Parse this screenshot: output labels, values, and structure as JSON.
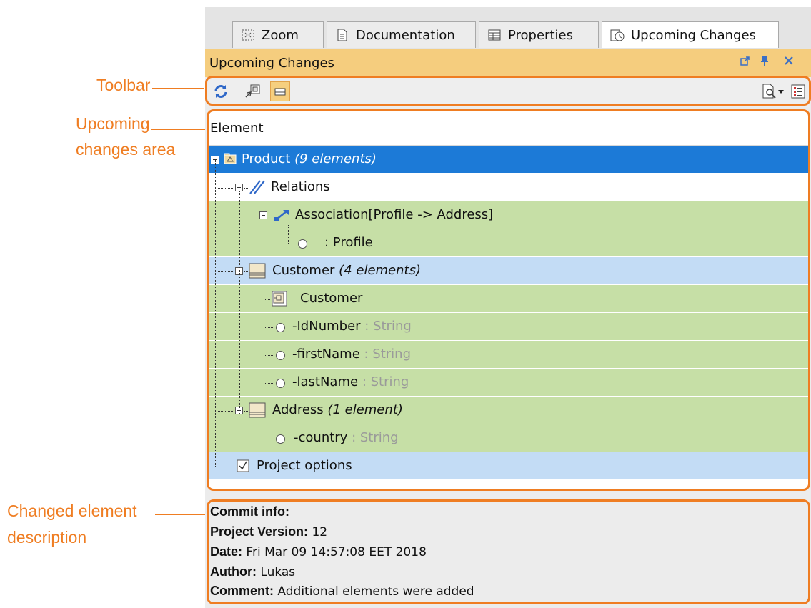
{
  "annotations": {
    "toolbar": "Toolbar",
    "upcoming_area_line1": "Upcoming",
    "upcoming_area_line2": "changes area",
    "description_line1": "Changed element",
    "description_line2": "description"
  },
  "tabs": [
    {
      "label": "Zoom",
      "icon": "zoom-icon"
    },
    {
      "label": "Documentation",
      "icon": "documentation-icon"
    },
    {
      "label": "Properties",
      "icon": "properties-icon"
    },
    {
      "label": "Upcoming Changes",
      "icon": "upcoming-changes-icon",
      "active": true
    }
  ],
  "panel": {
    "title": "Upcoming Changes",
    "controls": [
      "undock-icon",
      "pin-icon",
      "close-icon"
    ]
  },
  "toolbar": {
    "left_buttons": [
      "refresh-icon",
      "select-in-tree-icon",
      "show-description-icon"
    ],
    "right_buttons": [
      "find-icon",
      "dropdown-arrow-icon",
      "options-icon"
    ]
  },
  "tree": {
    "column_header": "Element",
    "rows": [
      {
        "label": "Product",
        "extra": "(9 elements)",
        "type": "",
        "style": "selected"
      },
      {
        "label": "Relations",
        "extra": "",
        "type": "",
        "style": "white"
      },
      {
        "label": "Association[Profile -> Address]",
        "extra": "",
        "type": "",
        "style": "green"
      },
      {
        "label": ": Profile",
        "extra": "",
        "type": "",
        "style": "green"
      },
      {
        "label": "Customer",
        "extra": "(4 elements)",
        "type": "",
        "style": "blue"
      },
      {
        "label": "Customer",
        "extra": "",
        "type": "",
        "style": "green"
      },
      {
        "label": "-IdNumber",
        "extra": "",
        "type": ": String",
        "style": "green"
      },
      {
        "label": "-firstName",
        "extra": "",
        "type": ": String",
        "style": "green"
      },
      {
        "label": "-lastName",
        "extra": "",
        "type": ": String",
        "style": "green"
      },
      {
        "label": "Address",
        "extra": "(1 element)",
        "type": "",
        "style": "green"
      },
      {
        "label": "-country",
        "extra": "",
        "type": ": String",
        "style": "green"
      },
      {
        "label": "Project options",
        "extra": "",
        "type": "",
        "style": "blue"
      }
    ]
  },
  "description": {
    "heading": "Commit info:",
    "version_label": "Project Version:",
    "version_value": "12",
    "date_label": "Date:",
    "date_value": "Fri Mar 09 14:57:08 EET 2018",
    "author_label": "Author:",
    "author_value": "Lukas",
    "comment_label": "Comment:",
    "comment_value": "Additional elements were added"
  },
  "colors": {
    "annotation": "#ef7d22",
    "selected_row": "#1c7ad7",
    "changed_row": "#c6dfa6",
    "group_row": "#c3dcf5",
    "titlebar": "#f5cd7e"
  }
}
